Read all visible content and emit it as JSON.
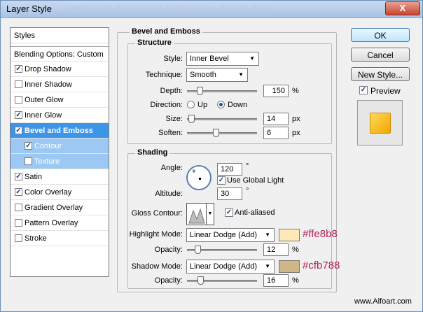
{
  "window": {
    "title": "Layer Style",
    "ghost_menu": "Image  Layer  Select  Filter  Analysis  View  Window  Help",
    "close_label": "X"
  },
  "styles_list": {
    "header": "Styles",
    "blending": "Blending Options: Custom",
    "items": [
      {
        "label": "Drop Shadow",
        "checked": true
      },
      {
        "label": "Inner Shadow",
        "checked": false
      },
      {
        "label": "Outer Glow",
        "checked": false
      },
      {
        "label": "Inner Glow",
        "checked": true
      },
      {
        "label": "Bevel and Emboss",
        "checked": true,
        "selected": true
      },
      {
        "label": "Contour",
        "checked": true,
        "sub": true
      },
      {
        "label": "Texture",
        "checked": false,
        "sub": true
      },
      {
        "label": "Satin",
        "checked": true
      },
      {
        "label": "Color Overlay",
        "checked": true
      },
      {
        "label": "Gradient Overlay",
        "checked": false
      },
      {
        "label": "Pattern Overlay",
        "checked": false
      },
      {
        "label": "Stroke",
        "checked": false
      }
    ]
  },
  "bevel": {
    "title": "Bevel and Emboss",
    "structure": {
      "title": "Structure",
      "style_label": "Style:",
      "style_value": "Inner Bevel",
      "technique_label": "Technique:",
      "technique_value": "Smooth",
      "depth_label": "Depth:",
      "depth_value": "150",
      "depth_unit": "%",
      "depth_level": 0.15,
      "direction_label": "Direction:",
      "dir_up": "Up",
      "dir_down": "Down",
      "direction_selected": "Down",
      "size_label": "Size:",
      "size_value": "14",
      "size_unit": "px",
      "size_level": 0.02,
      "soften_label": "Soften:",
      "soften_value": "6",
      "soften_unit": "px",
      "soften_level": 0.4
    },
    "shading": {
      "title": "Shading",
      "angle_label": "Angle:",
      "angle_value": "120",
      "angle_unit": "°",
      "global_light_label": "Use Global Light",
      "global_light": true,
      "altitude_label": "Altitude:",
      "altitude_value": "30",
      "altitude_unit": "°",
      "gloss_label": "Gloss Contour:",
      "anti_aliased_label": "Anti-aliased",
      "anti_aliased": true,
      "highlight_mode_label": "Highlight Mode:",
      "highlight_mode_value": "Linear Dodge (Add)",
      "highlight_color": "#ffe8b8",
      "highlight_hex_label": "#ffe8b8",
      "highlight_opacity_label": "Opacity:",
      "highlight_opacity_value": "12",
      "highlight_opacity_unit": "%",
      "highlight_opacity_level": 0.12,
      "shadow_mode_label": "Shadow Mode:",
      "shadow_mode_value": "Linear Dodge (Add)",
      "shadow_color": "#cfb788",
      "shadow_hex_label": "#cfb788",
      "shadow_opacity_label": "Opacity:",
      "shadow_opacity_value": "16",
      "shadow_opacity_unit": "%",
      "shadow_opacity_level": 0.16
    }
  },
  "buttons": {
    "ok": "OK",
    "cancel": "Cancel",
    "new_style": "New Style...",
    "preview_label": "Preview",
    "preview_checked": true
  },
  "watermark": "www.Alfoart.com",
  "icons": {
    "close": "close-icon",
    "dropdown": "chevron-down-icon"
  }
}
